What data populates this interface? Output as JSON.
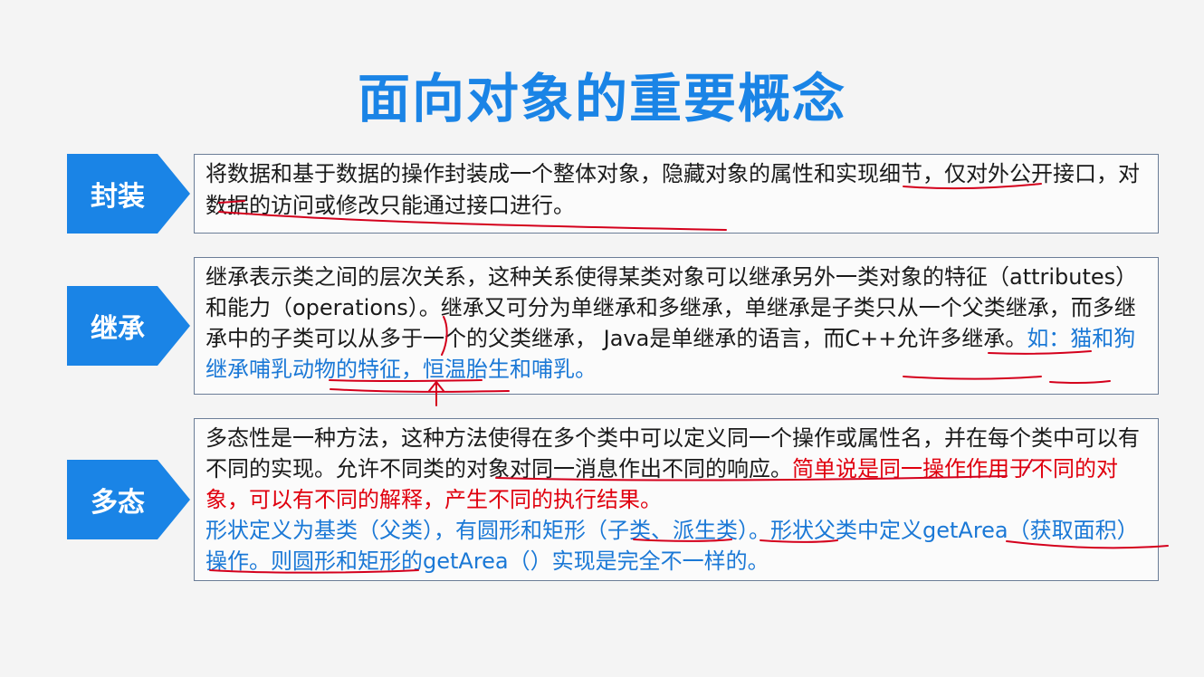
{
  "title": "面向对象的重要概念",
  "colors": {
    "title": "#1a84e6",
    "label_bg": "#1a84e6",
    "highlight_blue": "#1a78d6",
    "highlight_red": "#e0000e",
    "annotation_ink": "#d4001c"
  },
  "sections": [
    {
      "label": "封装",
      "text": "将数据和基于数据的操作封装成一个整体对象，隐藏对象的属性和实现细节，仅对外公开接口，对数据的访问或修改只能通过接口进行。"
    },
    {
      "label": "继承",
      "text_black": "继承表示类之间的层次关系，这种关系使得某类对象可以继承另外一类对象的特征（attributes）和能力（operations）。继承又可分为单继承和多继承，单继承是子类只从一个父类继承，而多继承中的子类可以从多于一个的父类继承， Java是单继承的语言，而C++允许多继承。",
      "text_blue": "如：猫和狗继承哺乳动物的特征，恒温胎生和哺乳。"
    },
    {
      "label": "多态",
      "text_black": "多态性是一种方法，这种方法使得在多个类中可以定义同一个操作或属性名，并在每个类中可以有不同的实现。允许不同类的对象对同一消息作出不同的响应。",
      "text_red": "简单说是同一操作作用于不同的对象，可以有不同的解释，产生不同的执行结果。",
      "text_blue": "形状定义为基类（父类），有圆形和矩形（子类、派生类）。形状父类中定义getArea（获取面积）操作。则圆形和矩形的getArea（）实现是完全不一样的。"
    }
  ]
}
